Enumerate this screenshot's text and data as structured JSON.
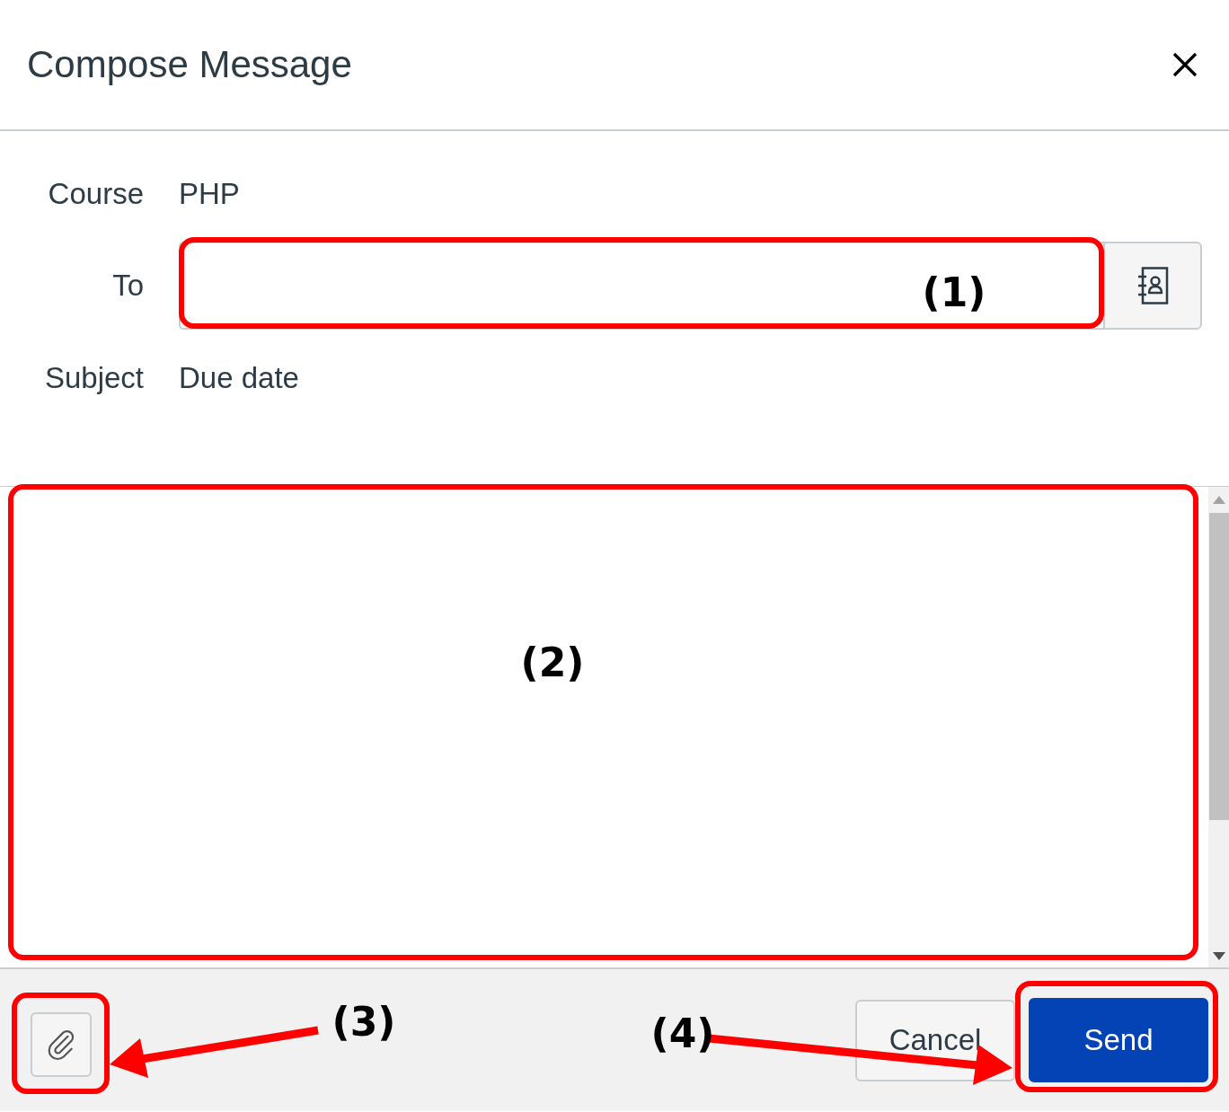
{
  "dialog": {
    "title": "Compose Message"
  },
  "fields": [
    {
      "kind": "text",
      "label": "Course",
      "value": "PHP"
    },
    {
      "kind": "recipients",
      "label": "To"
    },
    {
      "kind": "text",
      "label": "Subject",
      "value": "Due date"
    }
  ],
  "footer": {
    "buttons": [
      {
        "kind": "secondary",
        "label": "Cancel"
      },
      {
        "kind": "primary",
        "label": "Send"
      }
    ]
  },
  "annotations": [
    {
      "kind": "frame",
      "label": "(1)"
    },
    {
      "kind": "frame",
      "label": "(2)"
    },
    {
      "kind": "frame_arrow",
      "label": "(3)"
    },
    {
      "kind": "frame_arrow",
      "label": "(4)"
    }
  ]
}
